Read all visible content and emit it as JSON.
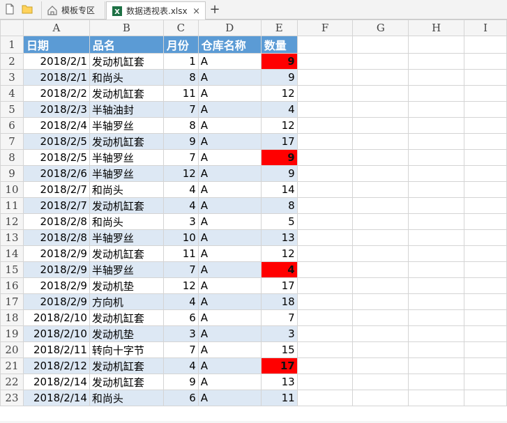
{
  "tabs": {
    "template_label": "模板专区",
    "file_label": "数据透视表.xlsx",
    "close_glyph": "×",
    "new_glyph": "+"
  },
  "columns": [
    "A",
    "B",
    "C",
    "D",
    "E",
    "F",
    "G",
    "H",
    "I"
  ],
  "header_row": {
    "row": "1",
    "cells": [
      "日期",
      "品名",
      "月份",
      "仓库名称",
      "数量"
    ]
  },
  "rows": [
    {
      "row": "2",
      "date": "2018/2/1",
      "name": "发动机缸套",
      "month": "1",
      "wh": "A",
      "qty": "9",
      "flag": true
    },
    {
      "row": "3",
      "date": "2018/2/1",
      "name": "和尚头",
      "month": "8",
      "wh": "A",
      "qty": "9",
      "flag": false
    },
    {
      "row": "4",
      "date": "2018/2/2",
      "name": "发动机缸套",
      "month": "11",
      "wh": "A",
      "qty": "12",
      "flag": false
    },
    {
      "row": "5",
      "date": "2018/2/3",
      "name": "半轴油封",
      "month": "7",
      "wh": "A",
      "qty": "4",
      "flag": false
    },
    {
      "row": "6",
      "date": "2018/2/4",
      "name": "半轴罗丝",
      "month": "8",
      "wh": "A",
      "qty": "12",
      "flag": false
    },
    {
      "row": "7",
      "date": "2018/2/5",
      "name": "发动机缸套",
      "month": "9",
      "wh": "A",
      "qty": "17",
      "flag": false
    },
    {
      "row": "8",
      "date": "2018/2/5",
      "name": "半轴罗丝",
      "month": "7",
      "wh": "A",
      "qty": "9",
      "flag": true
    },
    {
      "row": "9",
      "date": "2018/2/6",
      "name": "半轴罗丝",
      "month": "12",
      "wh": "A",
      "qty": "9",
      "flag": false
    },
    {
      "row": "10",
      "date": "2018/2/7",
      "name": "和尚头",
      "month": "4",
      "wh": "A",
      "qty": "14",
      "flag": false
    },
    {
      "row": "11",
      "date": "2018/2/7",
      "name": "发动机缸套",
      "month": "4",
      "wh": "A",
      "qty": "8",
      "flag": false
    },
    {
      "row": "12",
      "date": "2018/2/8",
      "name": "和尚头",
      "month": "3",
      "wh": "A",
      "qty": "5",
      "flag": false
    },
    {
      "row": "13",
      "date": "2018/2/8",
      "name": "半轴罗丝",
      "month": "10",
      "wh": "A",
      "qty": "13",
      "flag": false
    },
    {
      "row": "14",
      "date": "2018/2/9",
      "name": "发动机缸套",
      "month": "11",
      "wh": "A",
      "qty": "12",
      "flag": false
    },
    {
      "row": "15",
      "date": "2018/2/9",
      "name": "半轴罗丝",
      "month": "7",
      "wh": "A",
      "qty": "4",
      "flag": true
    },
    {
      "row": "16",
      "date": "2018/2/9",
      "name": "发动机垫",
      "month": "12",
      "wh": "A",
      "qty": "17",
      "flag": false
    },
    {
      "row": "17",
      "date": "2018/2/9",
      "name": "方向机",
      "month": "4",
      "wh": "A",
      "qty": "18",
      "flag": false
    },
    {
      "row": "18",
      "date": "2018/2/10",
      "name": "发动机缸套",
      "month": "6",
      "wh": "A",
      "qty": "7",
      "flag": false
    },
    {
      "row": "19",
      "date": "2018/2/10",
      "name": "发动机垫",
      "month": "3",
      "wh": "A",
      "qty": "3",
      "flag": false
    },
    {
      "row": "20",
      "date": "2018/2/11",
      "name": "转向十字节",
      "month": "7",
      "wh": "A",
      "qty": "15",
      "flag": false
    },
    {
      "row": "21",
      "date": "2018/2/12",
      "name": "发动机缸套",
      "month": "4",
      "wh": "A",
      "qty": "17",
      "flag": true
    },
    {
      "row": "22",
      "date": "2018/2/14",
      "name": "发动机缸套",
      "month": "9",
      "wh": "A",
      "qty": "13",
      "flag": false
    },
    {
      "row": "23",
      "date": "2018/2/14",
      "name": "和尚头",
      "month": "6",
      "wh": "A",
      "qty": "11",
      "flag": false
    }
  ],
  "colors": {
    "header_fill": "#5b9bd5",
    "band_fill": "#dde8f4",
    "highlight_fill": "#ff0000"
  }
}
